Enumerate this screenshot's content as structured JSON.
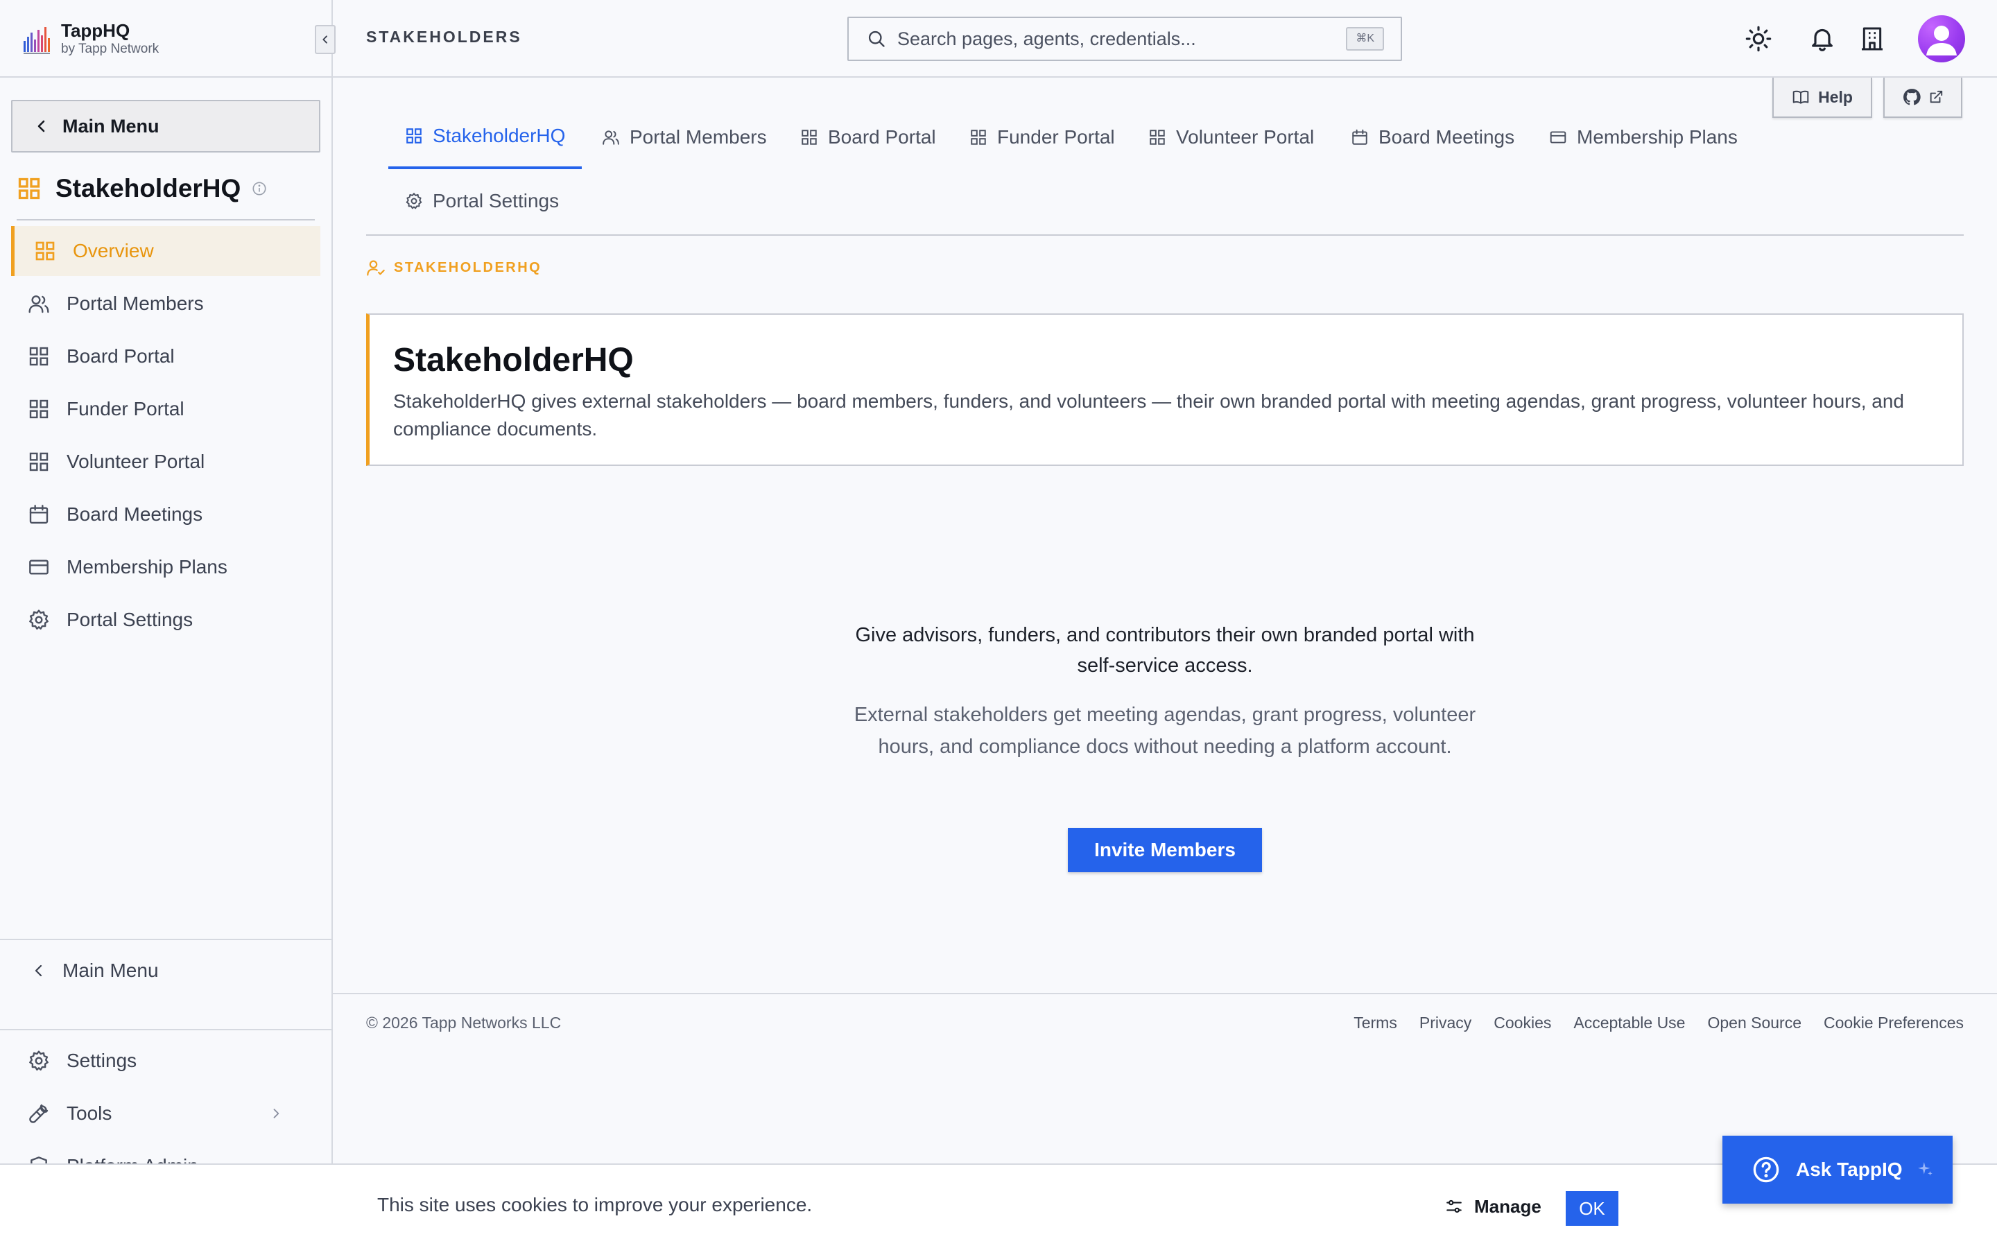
{
  "brand": {
    "title": "TappHQ",
    "subtitle": "by Tapp Network"
  },
  "sidebar": {
    "main_menu_label": "Main Menu",
    "section_title": "StakeholderHQ",
    "items": [
      {
        "label": "Overview",
        "icon": "grid-icon",
        "active": true
      },
      {
        "label": "Portal Members",
        "icon": "users-icon"
      },
      {
        "label": "Board Portal",
        "icon": "grid-icon"
      },
      {
        "label": "Funder Portal",
        "icon": "grid-icon"
      },
      {
        "label": "Volunteer Portal",
        "icon": "grid-icon"
      },
      {
        "label": "Board Meetings",
        "icon": "calendar-icon"
      },
      {
        "label": "Membership Plans",
        "icon": "credit-card-icon"
      },
      {
        "label": "Portal Settings",
        "icon": "gear-icon"
      }
    ],
    "bottom": {
      "main_menu_label": "Main Menu",
      "settings_label": "Settings",
      "tools_label": "Tools",
      "platform_admin_label": "Platform Admin"
    }
  },
  "topbar": {
    "title": "STAKEHOLDERS",
    "search_placeholder": "Search pages, agents, credentials...",
    "search_shortcut": "⌘K"
  },
  "main": {
    "help_label": "Help",
    "tabs": [
      {
        "label": "StakeholderHQ",
        "icon": "grid-icon",
        "active": true
      },
      {
        "label": "Portal Members",
        "icon": "users-icon"
      },
      {
        "label": "Board Portal",
        "icon": "grid-icon"
      },
      {
        "label": "Funder Portal",
        "icon": "grid-icon"
      },
      {
        "label": "Volunteer Portal",
        "icon": "grid-icon"
      },
      {
        "label": "Board Meetings",
        "icon": "calendar-icon"
      },
      {
        "label": "Membership Plans",
        "icon": "credit-card-icon"
      },
      {
        "label": "Portal Settings",
        "icon": "gear-icon"
      }
    ],
    "eyebrow": "STAKEHOLDERHQ",
    "intro": {
      "title": "StakeholderHQ",
      "description": "StakeholderHQ gives external stakeholders — board members, funders, and volunteers — their own branded portal with meeting agendas, grant progress, volunteer hours, and compliance documents."
    },
    "empty_state": {
      "heading": "Give advisors, funders, and contributors their own branded portal with self-service access.",
      "subtext": "External stakeholders get meeting agendas, grant progress, volunteer hours, and compliance docs without needing a platform account.",
      "cta_label": "Invite Members"
    }
  },
  "footer": {
    "copyright": "© 2026 Tapp Networks LLC",
    "links": [
      "Terms",
      "Privacy",
      "Cookies",
      "Acceptable Use",
      "Open Source",
      "Cookie Preferences"
    ]
  },
  "cookie_banner": {
    "text": "This site uses cookies to improve your experience.",
    "manage_label": "Manage",
    "ok_label": "OK"
  },
  "ask_button": {
    "label": "Ask TappIQ"
  },
  "colors": {
    "accent_blue": "#2563eb",
    "accent_orange": "#f0a020",
    "avatar_purple": "#9b3cf0"
  }
}
